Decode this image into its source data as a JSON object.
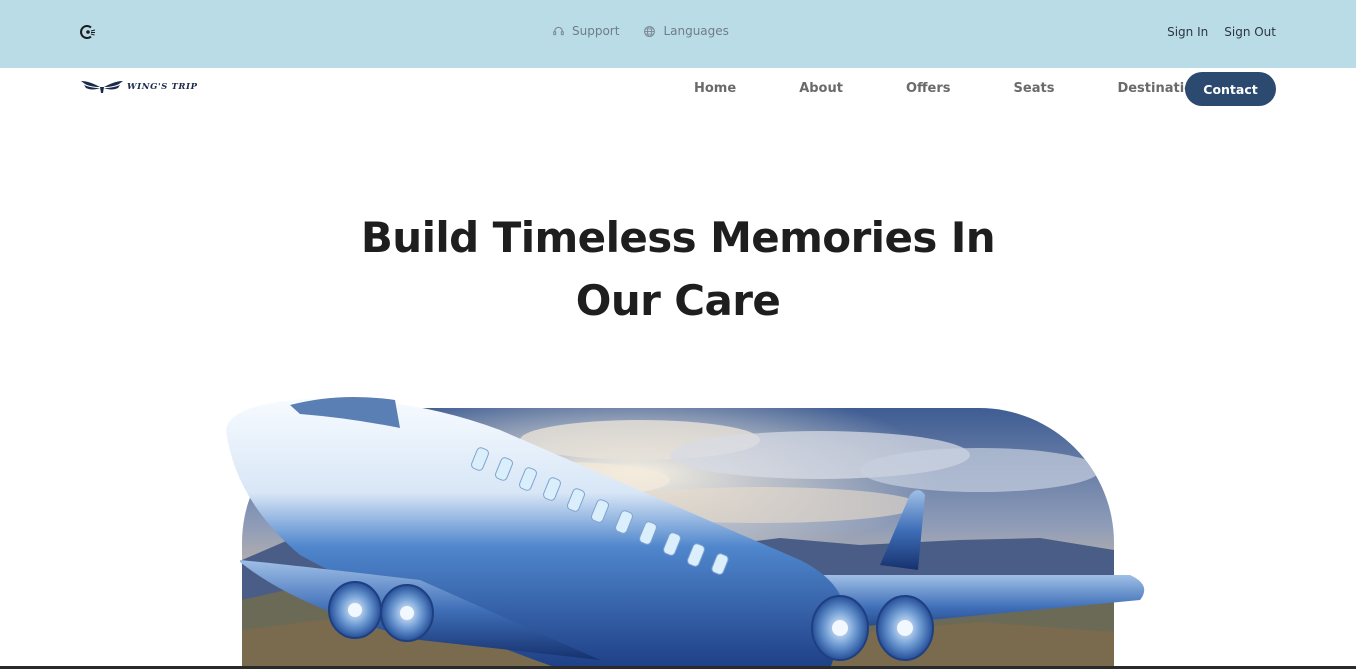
{
  "topbar": {
    "support_label": "Support",
    "languages_label": "Languages",
    "sign_in_label": "Sign In",
    "sign_out_label": "Sign Out",
    "logo_icon": "c-wings-icon"
  },
  "navbar": {
    "brand_text": "WING'S TRIP",
    "items": [
      {
        "label": "Home"
      },
      {
        "label": "About"
      },
      {
        "label": "Offers"
      },
      {
        "label": "Seats"
      },
      {
        "label": "Destinations"
      }
    ],
    "contact_label": "Contact"
  },
  "hero": {
    "title_line1": "Build Timeless Memories In",
    "title_line2": "Our Care",
    "image_alt": "airplane-over-mountains"
  },
  "colors": {
    "topbar_bg": "#badce6",
    "contact_bg": "#2c4a70",
    "title_color": "#1e1e1e"
  }
}
